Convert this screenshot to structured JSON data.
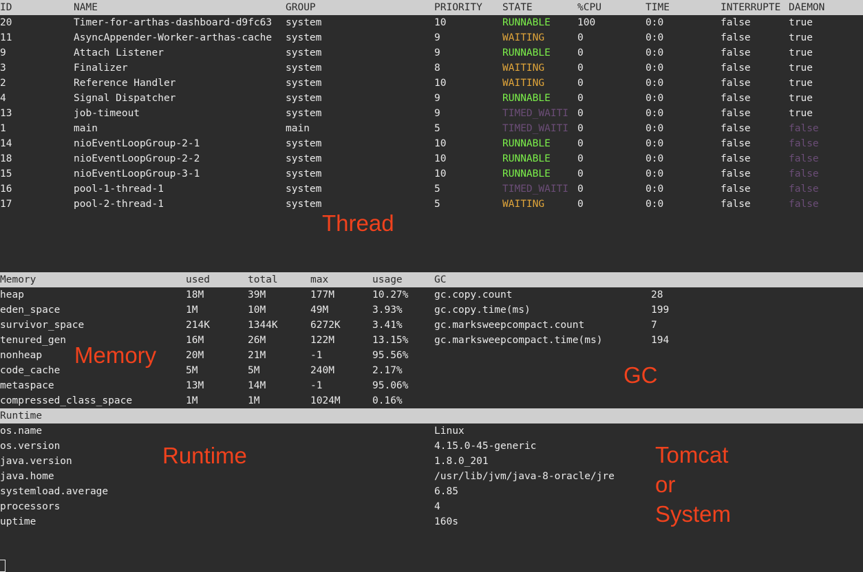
{
  "thread": {
    "headers": [
      "ID",
      "NAME",
      "GROUP",
      "PRIORITY",
      "STATE",
      "%CPU",
      "TIME",
      "INTERRUPTE",
      "DAEMON"
    ],
    "rows": [
      {
        "id": "20",
        "name": "Timer-for-arthas-dashboard-d9fc63",
        "group": "system",
        "priority": "10",
        "state": "RUNNABLE",
        "cpu": "100",
        "time": "0:0",
        "interrupted": "false",
        "daemon": "true"
      },
      {
        "id": "11",
        "name": "AsyncAppender-Worker-arthas-cache",
        "group": "system",
        "priority": "9",
        "state": "WAITING",
        "cpu": "0",
        "time": "0:0",
        "interrupted": "false",
        "daemon": "true"
      },
      {
        "id": "9",
        "name": "Attach Listener",
        "group": "system",
        "priority": "9",
        "state": "RUNNABLE",
        "cpu": "0",
        "time": "0:0",
        "interrupted": "false",
        "daemon": "true"
      },
      {
        "id": "3",
        "name": "Finalizer",
        "group": "system",
        "priority": "8",
        "state": "WAITING",
        "cpu": "0",
        "time": "0:0",
        "interrupted": "false",
        "daemon": "true"
      },
      {
        "id": "2",
        "name": "Reference Handler",
        "group": "system",
        "priority": "10",
        "state": "WAITING",
        "cpu": "0",
        "time": "0:0",
        "interrupted": "false",
        "daemon": "true"
      },
      {
        "id": "4",
        "name": "Signal Dispatcher",
        "group": "system",
        "priority": "9",
        "state": "RUNNABLE",
        "cpu": "0",
        "time": "0:0",
        "interrupted": "false",
        "daemon": "true"
      },
      {
        "id": "13",
        "name": "job-timeout",
        "group": "system",
        "priority": "9",
        "state": "TIMED_WAITI",
        "cpu": "0",
        "time": "0:0",
        "interrupted": "false",
        "daemon": "true"
      },
      {
        "id": "1",
        "name": "main",
        "group": "main",
        "priority": "5",
        "state": "TIMED_WAITI",
        "cpu": "0",
        "time": "0:0",
        "interrupted": "false",
        "daemon": "false"
      },
      {
        "id": "14",
        "name": "nioEventLoopGroup-2-1",
        "group": "system",
        "priority": "10",
        "state": "RUNNABLE",
        "cpu": "0",
        "time": "0:0",
        "interrupted": "false",
        "daemon": "false"
      },
      {
        "id": "18",
        "name": "nioEventLoopGroup-2-2",
        "group": "system",
        "priority": "10",
        "state": "RUNNABLE",
        "cpu": "0",
        "time": "0:0",
        "interrupted": "false",
        "daemon": "false"
      },
      {
        "id": "15",
        "name": "nioEventLoopGroup-3-1",
        "group": "system",
        "priority": "10",
        "state": "RUNNABLE",
        "cpu": "0",
        "time": "0:0",
        "interrupted": "false",
        "daemon": "false"
      },
      {
        "id": "16",
        "name": "pool-1-thread-1",
        "group": "system",
        "priority": "5",
        "state": "TIMED_WAITI",
        "cpu": "0",
        "time": "0:0",
        "interrupted": "false",
        "daemon": "false"
      },
      {
        "id": "17",
        "name": "pool-2-thread-1",
        "group": "system",
        "priority": "5",
        "state": "WAITING",
        "cpu": "0",
        "time": "0:0",
        "interrupted": "false",
        "daemon": "false"
      }
    ]
  },
  "memory": {
    "headers": [
      "Memory",
      "used",
      "total",
      "max",
      "usage"
    ],
    "rows": [
      {
        "name": "heap",
        "used": "18M",
        "total": "39M",
        "max": "177M",
        "usage": "10.27%"
      },
      {
        "name": "eden_space",
        "used": "1M",
        "total": "10M",
        "max": "49M",
        "usage": "3.93%"
      },
      {
        "name": "survivor_space",
        "used": "214K",
        "total": "1344K",
        "max": "6272K",
        "usage": "3.41%"
      },
      {
        "name": "tenured_gen",
        "used": "16M",
        "total": "26M",
        "max": "122M",
        "usage": "13.15%"
      },
      {
        "name": "nonheap",
        "used": "20M",
        "total": "21M",
        "max": "-1",
        "usage": "95.56%"
      },
      {
        "name": "code_cache",
        "used": "5M",
        "total": "5M",
        "max": "240M",
        "usage": "2.17%"
      },
      {
        "name": "metaspace",
        "used": "13M",
        "total": "14M",
        "max": "-1",
        "usage": "95.06%"
      },
      {
        "name": "compressed_class_space",
        "used": "1M",
        "total": "1M",
        "max": "1024M",
        "usage": "0.16%"
      }
    ]
  },
  "gc": {
    "header": "GC",
    "rows": [
      {
        "key": "gc.copy.count",
        "value": "28"
      },
      {
        "key": "gc.copy.time(ms)",
        "value": "199"
      },
      {
        "key": "gc.marksweepcompact.count",
        "value": "7"
      },
      {
        "key": "gc.marksweepcompact.time(ms)",
        "value": "194"
      }
    ]
  },
  "runtime": {
    "header": "Runtime",
    "rows": [
      {
        "key": "os.name",
        "value": "Linux"
      },
      {
        "key": "os.version",
        "value": "4.15.0-45-generic"
      },
      {
        "key": "java.version",
        "value": "1.8.0_201"
      },
      {
        "key": "java.home",
        "value": "/usr/lib/jvm/java-8-oracle/jre"
      },
      {
        "key": "systemload.average",
        "value": "6.85"
      },
      {
        "key": "processors",
        "value": "4"
      },
      {
        "key": "uptime",
        "value": "160s"
      }
    ]
  },
  "annotations": {
    "thread": "Thread",
    "memory": "Memory",
    "gc": "GC",
    "runtime": "Runtime",
    "tomcat_system": "Tomcat\nor\nSystem"
  },
  "colors": {
    "background": "#2c2c2c",
    "header_bar": "#cfcfcf",
    "runnable": "#7cf04a",
    "waiting": "#e0a53a",
    "timed_waiting": "#6b4d77",
    "daemon_false": "#6b4d77",
    "annotation": "#f0421d"
  }
}
